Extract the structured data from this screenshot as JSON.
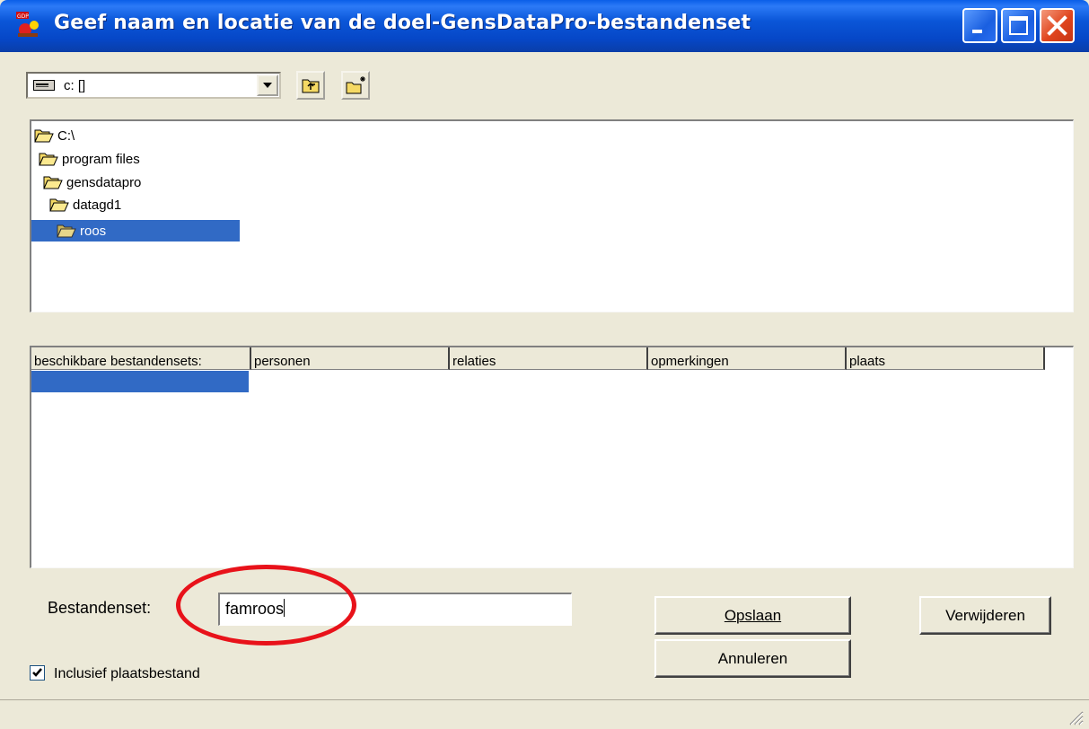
{
  "window": {
    "title": "Geef naam en locatie van de doel-GensDataPro-bestandenset",
    "app_icon": "gensdatapro-app-icon"
  },
  "title_buttons": {
    "minimize": "minimize-icon",
    "maximize": "maximize-icon",
    "close": "close-icon"
  },
  "drive_combo": {
    "value": "c: []",
    "icon": "drive-icon"
  },
  "toolbar": {
    "up_icon": "folder-up-icon",
    "new_folder_icon": "new-folder-icon"
  },
  "tree": {
    "items": [
      {
        "label": "C:\\",
        "selected": false
      },
      {
        "label": "program files",
        "selected": false
      },
      {
        "label": "gensdatapro",
        "selected": false
      },
      {
        "label": "datagd1",
        "selected": false
      },
      {
        "label": "roos",
        "selected": true
      }
    ]
  },
  "list": {
    "columns": [
      "beschikbare bestandensets:",
      "personen",
      "relaties",
      "opmerkingen",
      "plaats"
    ],
    "rows": []
  },
  "form": {
    "bestandenset_label": "Bestandenset:",
    "bestandenset_value": "famroos",
    "include_label": "Inclusief plaatsbestand",
    "include_checked": true
  },
  "buttons": {
    "save": "Opslaan",
    "save_mnemonic": "O",
    "cancel": "Annuleren",
    "delete": "Verwijderen"
  },
  "annotation": {
    "oval_color": "#e8121a"
  },
  "colors": {
    "titlebar": "#0a56d8",
    "selection": "#316ac5",
    "face": "#ece9d8"
  }
}
